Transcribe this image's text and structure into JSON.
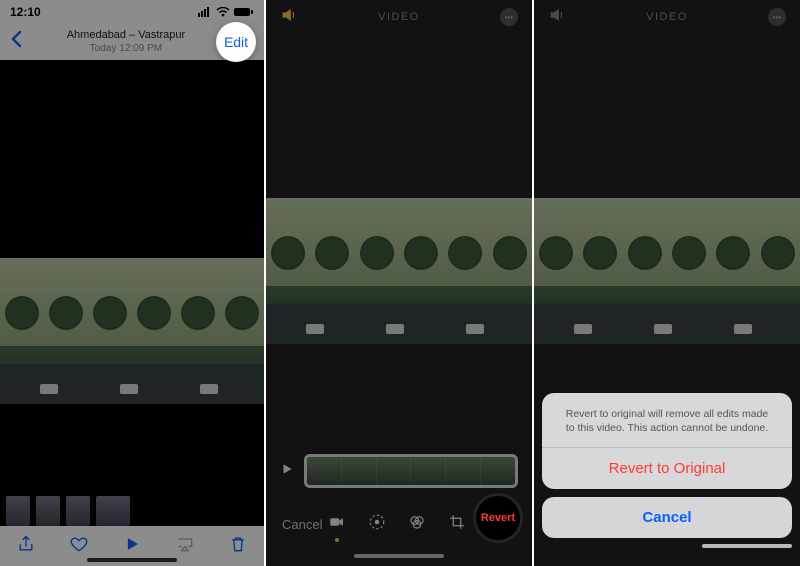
{
  "panel1": {
    "status": {
      "time": "12:10"
    },
    "location": "Ahmedabad – Vastrapur",
    "timestamp": "Today 12:09 PM",
    "edit_label": "Edit"
  },
  "panel2": {
    "header": "VIDEO",
    "cancel": "Cancel",
    "revert": "Revert"
  },
  "panel3": {
    "header": "VIDEO",
    "sheet": {
      "message": "Revert to original will remove all edits made to this video. This action cannot be undone.",
      "revert_action": "Revert to Original",
      "cancel_action": "Cancel"
    }
  }
}
